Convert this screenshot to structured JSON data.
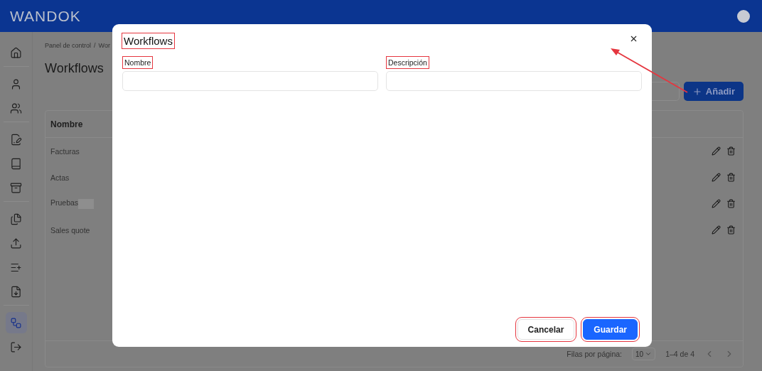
{
  "app_bar": {
    "logo": "WANDOK"
  },
  "sidebar": {
    "groups": [
      {
        "items": [
          {
            "selected": false
          }
        ]
      },
      {
        "items": [
          {
            "selected": false
          },
          {
            "selected": false
          }
        ]
      },
      {
        "items": [
          {
            "selected": false
          },
          {
            "selected": false
          },
          {
            "selected": false
          }
        ]
      },
      {
        "items": [
          {
            "selected": false
          },
          {
            "selected": false
          },
          {
            "selected": false
          },
          {
            "selected": false
          }
        ]
      },
      {
        "items": [
          {
            "selected": true
          },
          {
            "selected": false
          }
        ]
      }
    ]
  },
  "breadcrumb": {
    "separator": "/",
    "items": [
      "Panel de control",
      "Wor"
    ]
  },
  "page_title": "Workflows",
  "add_button": "Añadir",
  "table": {
    "columns": [
      "Nombre"
    ],
    "rows": [
      {
        "name": "Facturas",
        "redacted": false
      },
      {
        "name": "Actas",
        "redacted": false
      },
      {
        "name": "Pruebas",
        "redacted": true
      },
      {
        "name": "Sales quote",
        "redacted": false
      }
    ],
    "footer": {
      "rows_per_page_label": "Filas por página:",
      "rows_per_page": "10",
      "range": "1–4 de 4"
    }
  },
  "dialog": {
    "title": "Workflows",
    "title_highlighted": true,
    "fields": [
      {
        "label": "Nombre",
        "highlighted": true
      },
      {
        "label": "Descripción",
        "highlighted": true
      }
    ],
    "buttons": [
      {
        "label": "Cancelar",
        "kind": "secondary",
        "highlighted": true
      },
      {
        "label": "Guardar",
        "kind": "primary",
        "highlighted": true
      }
    ]
  }
}
